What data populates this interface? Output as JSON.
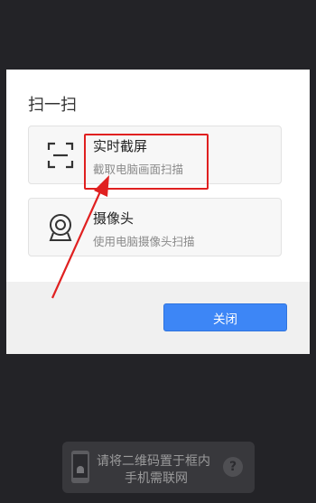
{
  "dialog": {
    "title": "扫一扫",
    "options": [
      {
        "icon": "screen-capture-icon",
        "label": "实时截屏",
        "description": "截取电脑画面扫描"
      },
      {
        "icon": "webcam-icon",
        "label": "摄像头",
        "description": "使用电脑摄像头扫描"
      }
    ],
    "close_label": "关闭"
  },
  "annotation": {
    "color": "#e02020"
  },
  "toast": {
    "line1": "请将二维码置于框内",
    "line2": "手机需联网",
    "help_glyph": "?",
    "icon": "android-phone-icon"
  },
  "colors": {
    "accent": "#3d86f6",
    "background": "#232327",
    "annotation": "#e02020"
  }
}
